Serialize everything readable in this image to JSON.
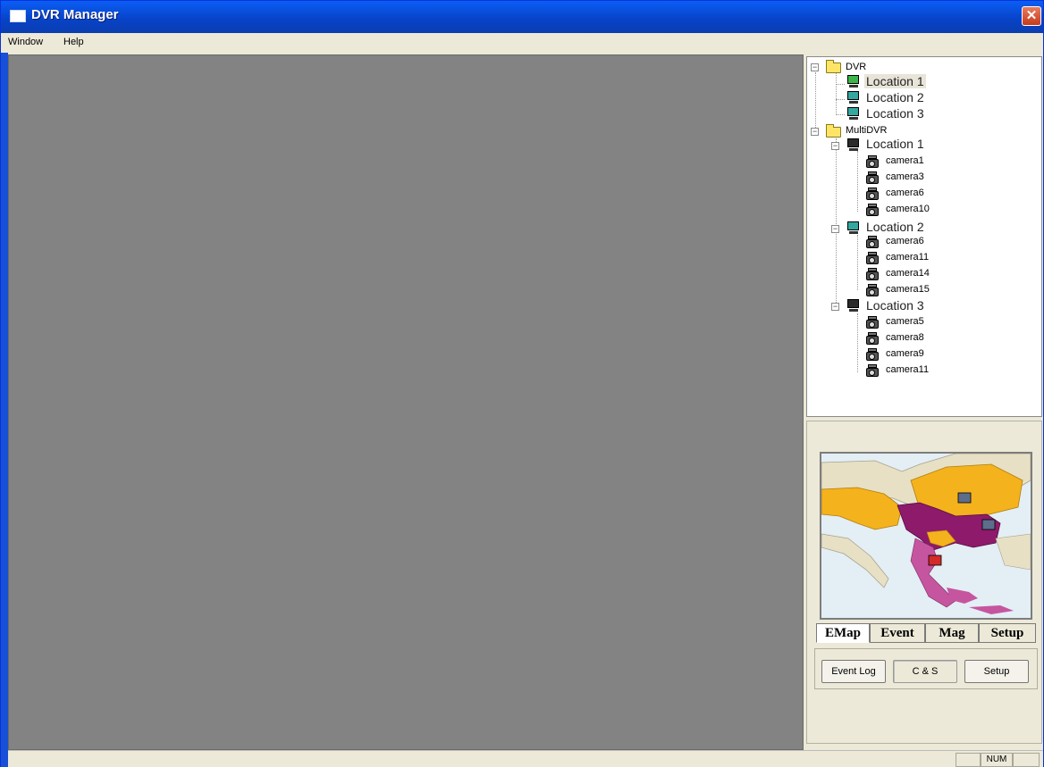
{
  "window": {
    "title": "DVR Manager",
    "close_glyph": "✕"
  },
  "menu": [
    {
      "label": "Window"
    },
    {
      "label": "Help"
    }
  ],
  "tree": {
    "dvr": {
      "label": "DVR",
      "locations": [
        "Location 1",
        "Location 2",
        "Location 3"
      ]
    },
    "multidvr": {
      "label": "MultiDVR",
      "locations": [
        {
          "label": "Location 1",
          "cameras": [
            "camera1",
            "camera3",
            "camera6",
            "camera10"
          ]
        },
        {
          "label": "Location 2",
          "cameras": [
            "camera6",
            "camera11",
            "camera14",
            "camera15"
          ]
        },
        {
          "label": "Location 3",
          "cameras": [
            "camera5",
            "camera8",
            "camera9",
            "camera11"
          ]
        }
      ]
    }
  },
  "tabs": [
    "EMap",
    "Event",
    "Mag",
    "Setup"
  ],
  "active_tab": "EMap",
  "buttons": {
    "event_log": "Event Log",
    "cs": "C & S",
    "setup": "Setup"
  },
  "status": {
    "num": "NUM"
  },
  "icons": [
    "folder-icon",
    "monitor-icon",
    "camera-icon",
    "close-icon",
    "app-icon"
  ],
  "colors": {
    "title_bar": "#0842c6",
    "video_bg": "#838383",
    "panel_bg": "#ece9d8"
  }
}
